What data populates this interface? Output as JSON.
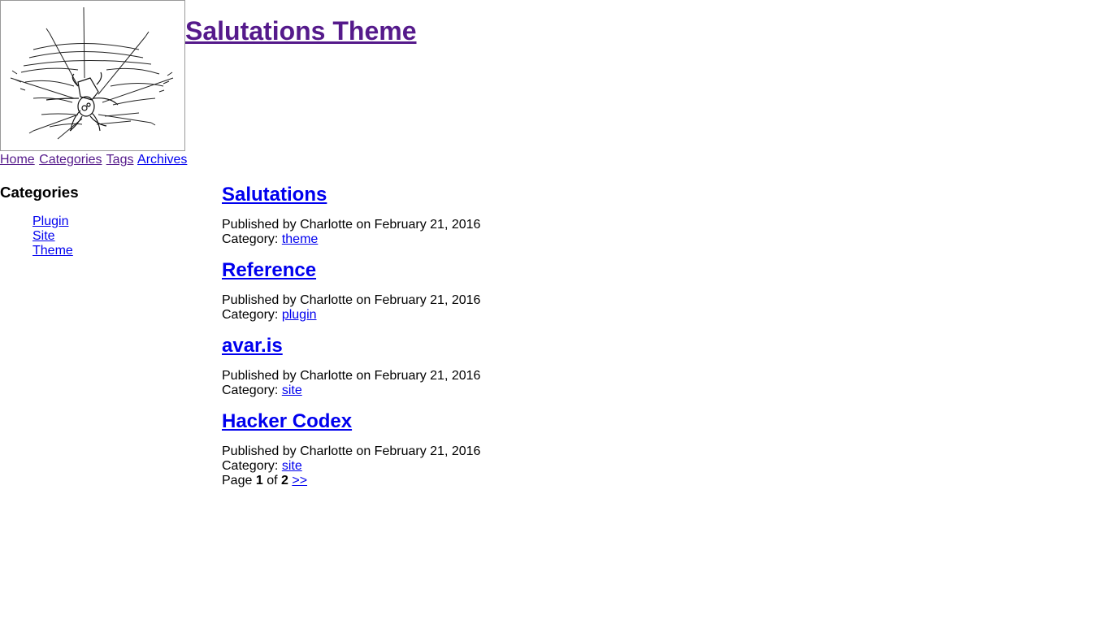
{
  "header": {
    "site_title": "Salutations Theme",
    "logo_icon": "spider-web-icon"
  },
  "nav": {
    "items": [
      {
        "label": "Home"
      },
      {
        "label": "Categories"
      },
      {
        "label": "Tags"
      },
      {
        "label": "Archives"
      }
    ]
  },
  "sidebar": {
    "heading": "Categories",
    "items": [
      {
        "label": "Plugin"
      },
      {
        "label": "Site"
      },
      {
        "label": "Theme"
      }
    ]
  },
  "posts": [
    {
      "title": "Salutations",
      "meta": "Published by Charlotte on February 21, 2016",
      "category_label": "Category:",
      "category": "theme"
    },
    {
      "title": "Reference",
      "meta": "Published by Charlotte on February 21, 2016",
      "category_label": "Category:",
      "category": "plugin"
    },
    {
      "title": "avar.is",
      "meta": "Published by Charlotte on February 21, 2016",
      "category_label": "Category:",
      "category": "site"
    },
    {
      "title": "Hacker Codex",
      "meta": "Published by Charlotte on February 21, 2016",
      "category_label": "Category:",
      "category": "site"
    }
  ],
  "pager": {
    "prefix": "Page",
    "current": "1",
    "of": "of",
    "total": "2",
    "next_label": ">>"
  },
  "colors": {
    "link": "#0000ee",
    "visited_link": "#551a8b"
  }
}
